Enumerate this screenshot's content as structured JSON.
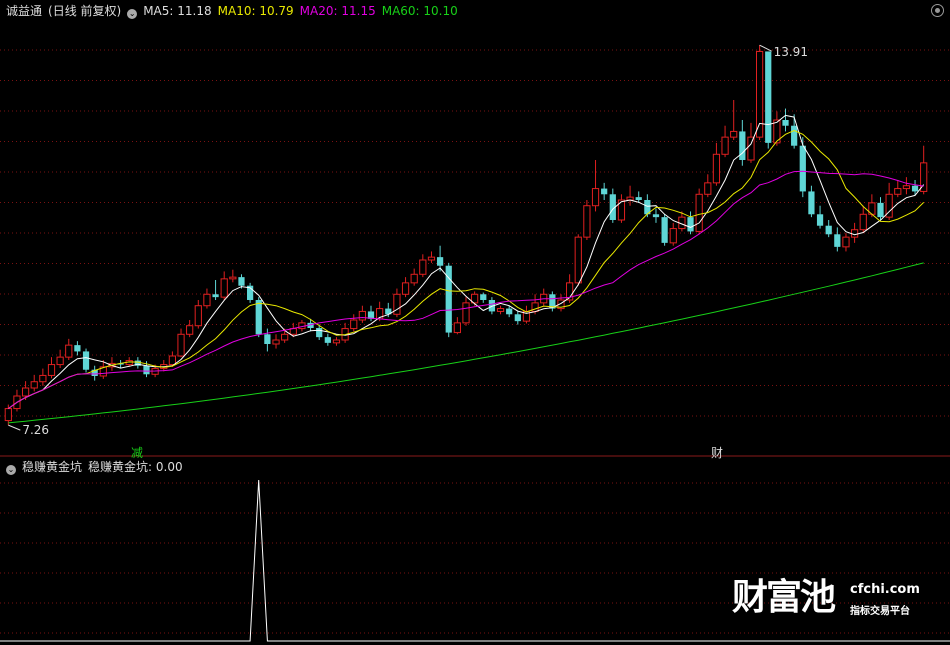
{
  "header": {
    "stock_name": "诚益通",
    "period_label": "(日线 前复权)",
    "ma5": "MA5: 11.18",
    "ma10": "MA10: 10.79",
    "ma20": "MA20: 11.15",
    "ma60": "MA60: 10.10"
  },
  "indicator": {
    "name": "稳赚黄金坑",
    "value_label": "稳赚黄金坑: 0.00"
  },
  "markers": {
    "high_label": "13.91",
    "low_label": "7.26",
    "tag_left": "减",
    "tag_right": "财"
  },
  "watermark": {
    "brand": "财富池",
    "site": "cfchi.com",
    "slogan": "指标交易平台"
  },
  "colors": {
    "background": "#000000",
    "grid": "#7a1212",
    "up": "#e02020",
    "down": "#5fd6d6",
    "ma5": "#ffffff",
    "ma10": "#e8e800",
    "ma20": "#e000e0",
    "ma60": "#18d018",
    "header_ma5": "#dddddd",
    "header_ma10": "#e8e800",
    "header_ma20": "#e000e0",
    "header_ma60": "#18d018"
  },
  "chart_data": {
    "type": "candlestick",
    "y_axis": {
      "min": 7.0,
      "max": 14.35
    },
    "high_value": 13.91,
    "low_value": 7.26,
    "candles": [
      [
        7.34,
        7.55,
        7.26,
        7.62
      ],
      [
        7.55,
        7.77,
        7.5,
        7.88
      ],
      [
        7.77,
        7.91,
        7.7,
        8.03
      ],
      [
        7.91,
        8.02,
        7.85,
        8.14
      ],
      [
        8.02,
        8.13,
        7.95,
        8.25
      ],
      [
        8.13,
        8.32,
        8.08,
        8.45
      ],
      [
        8.32,
        8.45,
        8.26,
        8.58
      ],
      [
        8.45,
        8.66,
        8.4,
        8.77
      ],
      [
        8.66,
        8.55,
        8.48,
        8.73
      ],
      [
        8.55,
        8.23,
        8.18,
        8.6
      ],
      [
        8.23,
        8.12,
        8.04,
        8.3
      ],
      [
        8.12,
        8.28,
        8.07,
        8.4
      ],
      [
        8.28,
        8.34,
        8.21,
        8.45
      ],
      [
        8.34,
        8.32,
        8.26,
        8.4
      ],
      [
        8.32,
        8.39,
        8.28,
        8.45
      ],
      [
        8.39,
        8.3,
        8.25,
        8.45
      ],
      [
        8.3,
        8.15,
        8.1,
        8.38
      ],
      [
        8.15,
        8.25,
        8.1,
        8.32
      ],
      [
        8.25,
        8.32,
        8.2,
        8.4
      ],
      [
        8.32,
        8.47,
        8.28,
        8.55
      ],
      [
        8.47,
        8.85,
        8.45,
        8.95
      ],
      [
        8.85,
        9.0,
        8.8,
        9.1
      ],
      [
        9.0,
        9.35,
        8.95,
        9.45
      ],
      [
        9.35,
        9.55,
        9.3,
        9.65
      ],
      [
        9.55,
        9.5,
        9.45,
        9.8
      ],
      [
        9.5,
        9.82,
        9.45,
        9.95
      ],
      [
        9.82,
        9.85,
        9.76,
        9.98
      ],
      [
        9.85,
        9.7,
        9.65,
        9.9
      ],
      [
        9.7,
        9.45,
        9.4,
        9.75
      ],
      [
        9.45,
        8.85,
        8.8,
        9.5
      ],
      [
        8.85,
        8.68,
        8.55,
        8.95
      ],
      [
        8.68,
        8.75,
        8.6,
        8.85
      ],
      [
        8.75,
        8.85,
        8.7,
        8.95
      ],
      [
        8.85,
        8.95,
        8.8,
        9.05
      ],
      [
        8.95,
        9.05,
        8.9,
        9.1
      ],
      [
        9.05,
        8.96,
        8.9,
        9.12
      ],
      [
        8.96,
        8.8,
        8.75,
        9.02
      ],
      [
        8.8,
        8.7,
        8.65,
        8.86
      ],
      [
        8.7,
        8.75,
        8.65,
        8.8
      ],
      [
        8.75,
        8.95,
        8.7,
        9.05
      ],
      [
        8.95,
        9.1,
        8.9,
        9.2
      ],
      [
        9.1,
        9.25,
        9.05,
        9.35
      ],
      [
        9.25,
        9.12,
        9.08,
        9.35
      ],
      [
        9.12,
        9.3,
        9.08,
        9.42
      ],
      [
        9.3,
        9.2,
        9.15,
        9.4
      ],
      [
        9.2,
        9.55,
        9.15,
        9.65
      ],
      [
        9.55,
        9.75,
        9.5,
        9.85
      ],
      [
        9.75,
        9.9,
        9.7,
        10.0
      ],
      [
        9.9,
        10.15,
        9.85,
        10.25
      ],
      [
        10.15,
        10.2,
        10.1,
        10.3
      ],
      [
        10.2,
        10.05,
        9.95,
        10.4
      ],
      [
        10.05,
        8.88,
        8.8,
        10.1
      ],
      [
        8.88,
        9.05,
        8.85,
        9.15
      ],
      [
        9.05,
        9.4,
        9.0,
        9.5
      ],
      [
        9.4,
        9.55,
        9.35,
        9.6
      ],
      [
        9.55,
        9.45,
        9.4,
        9.58
      ],
      [
        9.45,
        9.25,
        9.2,
        9.5
      ],
      [
        9.25,
        9.3,
        9.2,
        9.35
      ],
      [
        9.3,
        9.2,
        9.15,
        9.35
      ],
      [
        9.2,
        9.08,
        9.02,
        9.25
      ],
      [
        9.08,
        9.25,
        9.04,
        9.35
      ],
      [
        9.25,
        9.4,
        9.2,
        9.55
      ],
      [
        9.4,
        9.55,
        9.35,
        9.65
      ],
      [
        9.55,
        9.3,
        9.25,
        9.6
      ],
      [
        9.3,
        9.45,
        9.25,
        9.55
      ],
      [
        9.45,
        9.75,
        9.4,
        9.9
      ],
      [
        9.75,
        10.55,
        9.7,
        10.6
      ],
      [
        10.55,
        11.1,
        10.5,
        11.2
      ],
      [
        11.1,
        11.4,
        11.0,
        11.9
      ],
      [
        11.4,
        11.3,
        11.2,
        11.5
      ],
      [
        11.3,
        10.85,
        10.8,
        11.4
      ],
      [
        10.85,
        11.2,
        10.8,
        11.3
      ],
      [
        11.2,
        11.25,
        11.1,
        11.45
      ],
      [
        11.25,
        11.2,
        11.15,
        11.35
      ],
      [
        11.2,
        10.95,
        10.9,
        11.3
      ],
      [
        10.95,
        10.9,
        10.8,
        11.05
      ],
      [
        10.9,
        10.45,
        10.4,
        10.95
      ],
      [
        10.45,
        10.7,
        10.4,
        10.8
      ],
      [
        10.7,
        10.9,
        10.65,
        11.0
      ],
      [
        10.9,
        10.65,
        10.6,
        11.0
      ],
      [
        10.65,
        11.3,
        10.6,
        11.4
      ],
      [
        11.3,
        11.5,
        11.25,
        11.65
      ],
      [
        11.5,
        12.0,
        11.45,
        12.2
      ],
      [
        12.0,
        12.3,
        11.95,
        12.5
      ],
      [
        12.3,
        12.4,
        12.25,
        12.95
      ],
      [
        12.4,
        11.9,
        11.8,
        12.6
      ],
      [
        11.9,
        12.3,
        11.85,
        12.55
      ],
      [
        12.3,
        13.8,
        12.25,
        13.91
      ],
      [
        13.8,
        12.2,
        12.1,
        13.0
      ],
      [
        12.2,
        12.6,
        12.15,
        12.75
      ],
      [
        12.6,
        12.5,
        12.4,
        12.8
      ],
      [
        12.5,
        12.15,
        12.1,
        12.7
      ],
      [
        12.15,
        11.35,
        11.25,
        12.3
      ],
      [
        11.35,
        10.95,
        10.9,
        11.45
      ],
      [
        10.95,
        10.75,
        10.7,
        11.1
      ],
      [
        10.75,
        10.6,
        10.55,
        10.85
      ],
      [
        10.6,
        10.38,
        10.3,
        10.72
      ],
      [
        10.38,
        10.55,
        10.3,
        10.62
      ],
      [
        10.55,
        10.68,
        10.45,
        10.8
      ],
      [
        10.68,
        10.95,
        10.62,
        11.1
      ],
      [
        10.95,
        11.15,
        10.9,
        11.3
      ],
      [
        11.15,
        10.9,
        10.85,
        11.25
      ],
      [
        10.9,
        11.3,
        10.85,
        11.5
      ],
      [
        11.3,
        11.4,
        11.25,
        11.55
      ],
      [
        11.4,
        11.45,
        11.3,
        11.6
      ],
      [
        11.45,
        11.35,
        11.28,
        11.55
      ],
      [
        11.35,
        11.85,
        11.3,
        12.15
      ]
    ],
    "ma5": [
      7.35,
      7.55,
      7.7,
      7.85,
      7.95,
      8.1,
      8.24,
      8.36,
      8.42,
      8.43,
      8.39,
      8.37,
      8.35,
      8.33,
      8.3,
      8.33,
      8.3,
      8.3,
      8.32,
      8.35,
      8.45,
      8.63,
      8.85,
      9.08,
      9.3,
      9.45,
      9.57,
      9.62,
      9.6,
      9.45,
      9.3,
      9.16,
      9.03,
      8.9,
      8.85,
      8.86,
      8.9,
      8.89,
      8.84,
      8.83,
      8.87,
      8.95,
      9.03,
      9.12,
      9.2,
      9.27,
      9.36,
      9.5,
      9.68,
      9.88,
      10.02,
      9.9,
      9.75,
      9.68,
      9.6,
      9.48,
      9.4,
      9.34,
      9.29,
      9.22,
      9.2,
      9.24,
      9.28,
      9.3,
      9.37,
      9.51,
      9.8,
      10.2,
      10.6,
      10.92,
      11.05,
      11.15,
      11.2,
      11.15,
      11.1,
      11.0,
      10.86,
      10.78,
      10.75,
      10.72,
      10.8,
      11.0,
      11.2,
      11.48,
      11.8,
      12.0,
      12.2,
      12.5,
      12.7,
      12.72,
      12.72,
      12.62,
      12.4,
      12.1,
      11.8,
      11.45,
      11.1,
      10.88,
      10.7,
      10.62,
      10.7,
      10.8,
      10.95,
      11.08,
      11.22,
      11.28,
      11.35
    ]
  },
  "indicator_data": {
    "type": "line",
    "values_nonzero": [
      {
        "bar": 29,
        "value": 1
      }
    ],
    "value_label": "0.00"
  }
}
